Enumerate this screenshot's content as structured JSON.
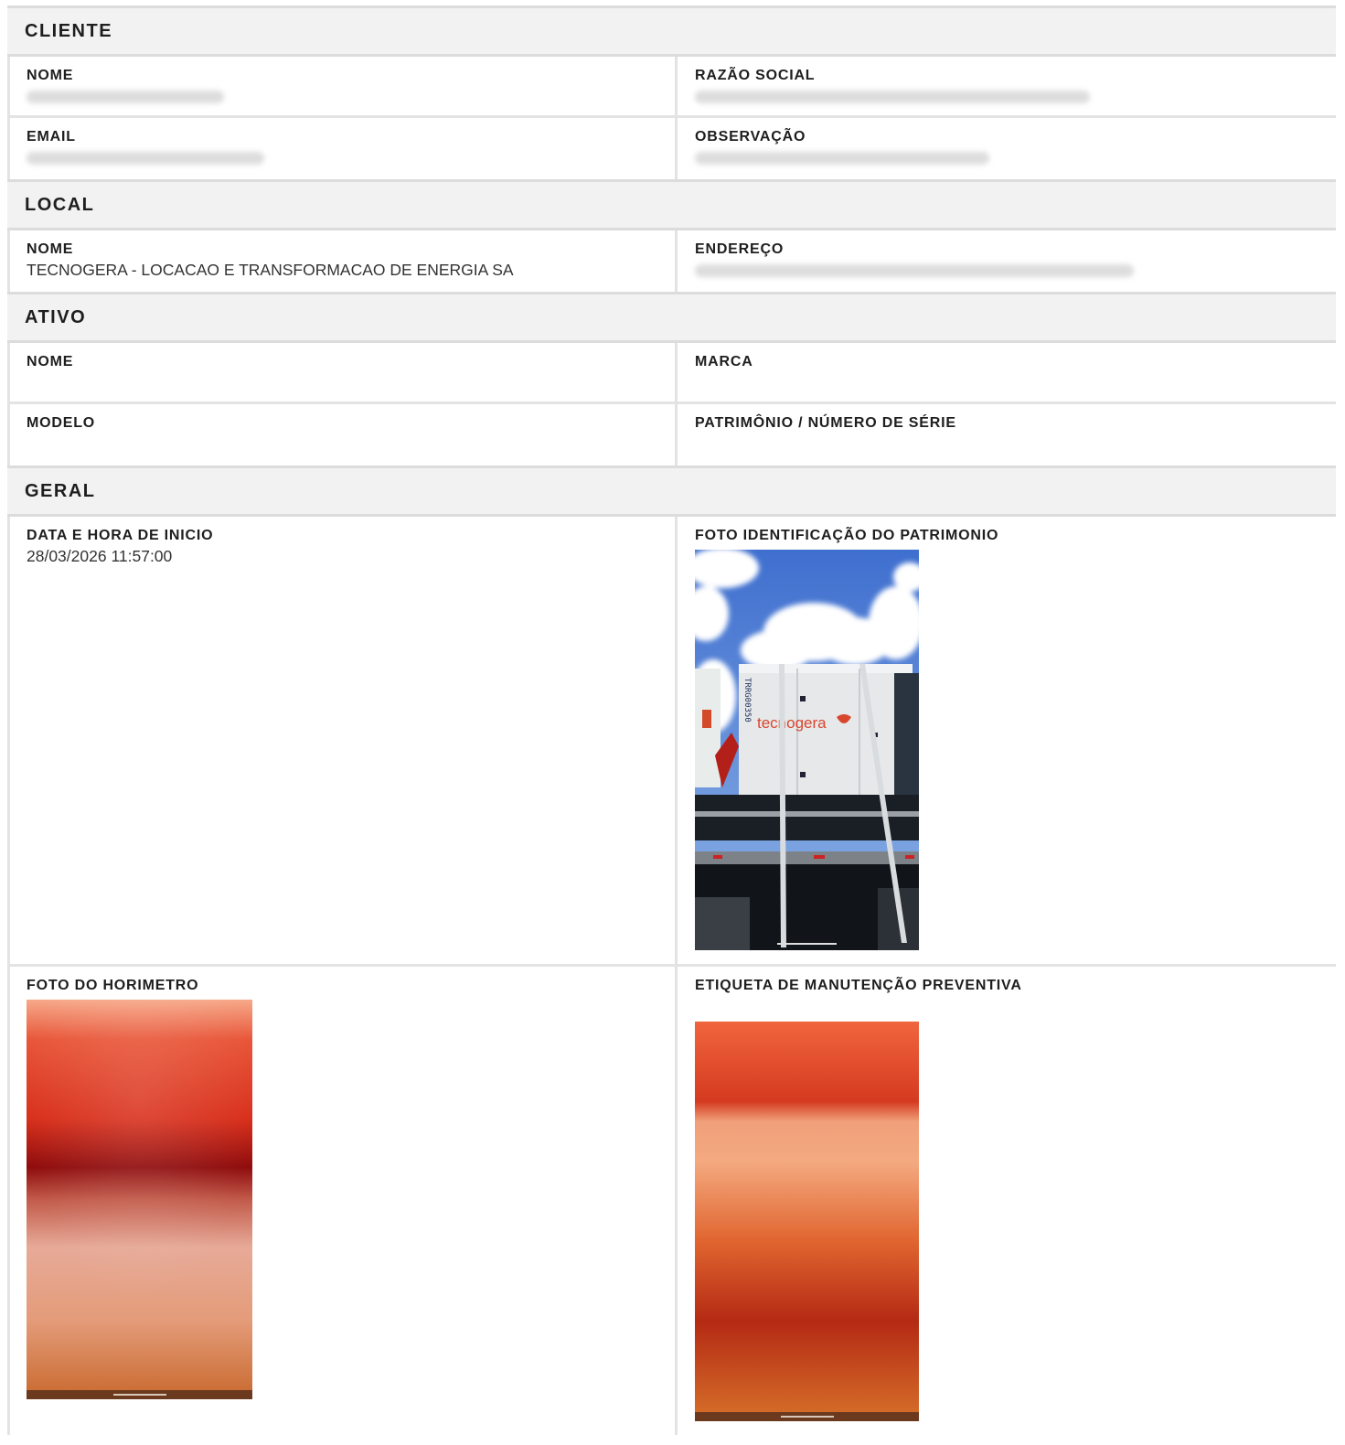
{
  "sections": {
    "cliente": {
      "title": "CLIENTE",
      "nome_label": "NOME",
      "razao_label": "RAZÃO SOCIAL",
      "email_label": "EMAIL",
      "observacao_label": "OBSERVAÇÃO"
    },
    "local": {
      "title": "LOCAL",
      "nome_label": "NOME",
      "nome_value": "TECNOGERA - LOCACAO E TRANSFORMACAO DE ENERGIA SA",
      "endereco_label": "ENDEREÇO"
    },
    "ativo": {
      "title": "ATIVO",
      "nome_label": "NOME",
      "marca_label": "MARCA",
      "modelo_label": "MODELO",
      "patrimonio_label": "PATRIMÔNIO / NÚMERO DE SÉRIE"
    },
    "geral": {
      "title": "GERAL",
      "data_label": "DATA E HORA DE INICIO",
      "data_value": "28/03/2026 11:57:00",
      "foto_patrimonio_label": "FOTO IDENTIFICAÇÃO DO PATRIMONIO",
      "foto_horimetro_label": "FOTO DO HORIMETRO",
      "etiqueta_label": "ETIQUETA DE MANUTENÇÃO PREVENTIVA"
    }
  },
  "photo_texts": {
    "brand": "tecnogera",
    "unit_code": "TRRG00350"
  }
}
